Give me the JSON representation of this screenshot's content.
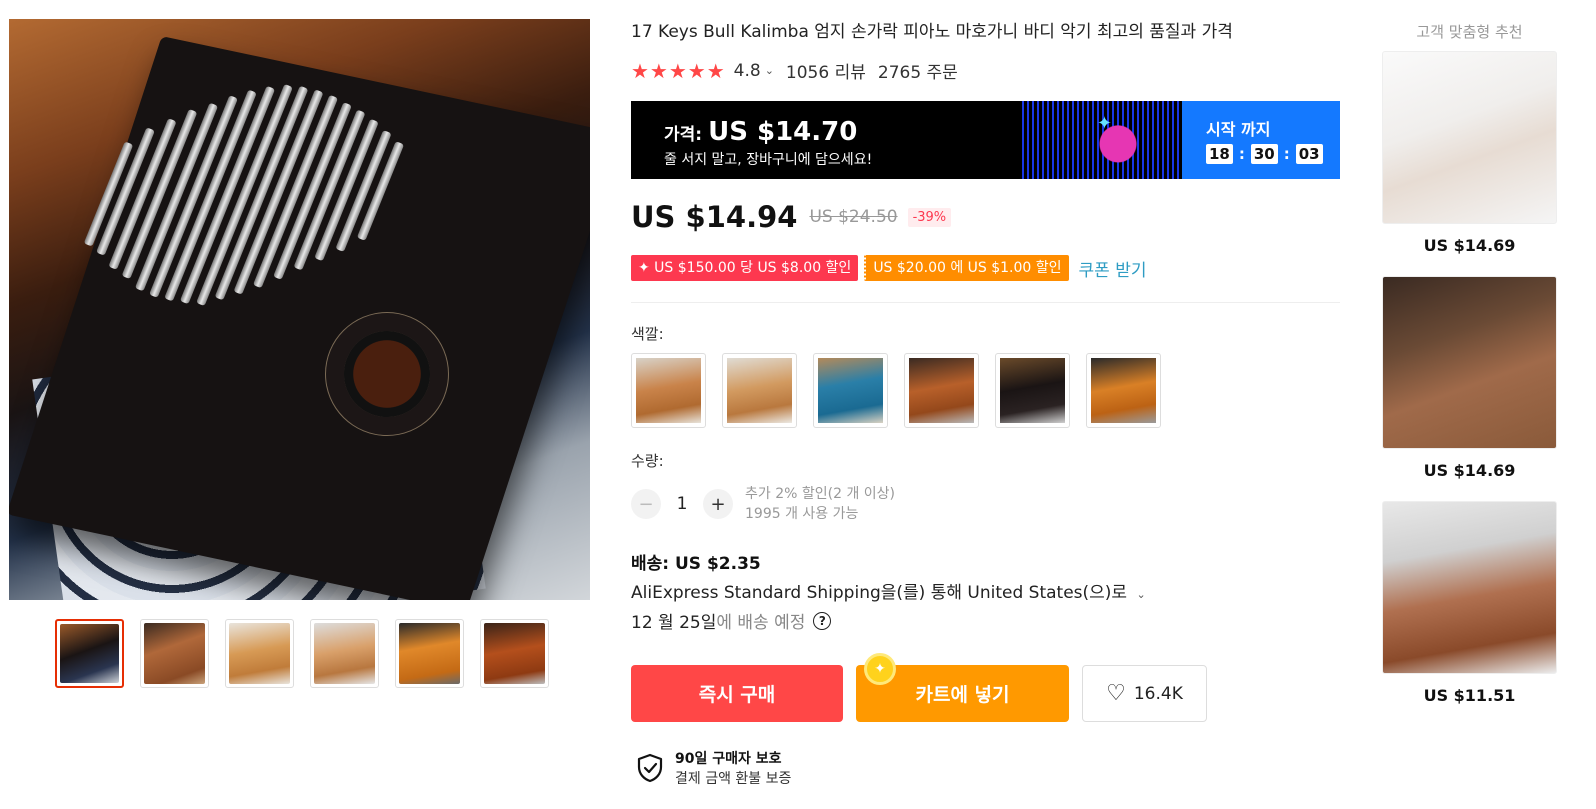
{
  "product": {
    "title": "17 Keys Bull Kalimba 엄지 손가락 피아노 마호가니 바디 악기 최고의 품질과 가격",
    "stars": "★★★★★",
    "rating": "4.8",
    "reviews": "1056 리뷰",
    "orders": "2765 주문"
  },
  "banner": {
    "price_label": "가격:",
    "price": "US $14.70",
    "subtitle": "줄 서지 말고, 장바구니에 담으세요!",
    "countdown_label": "시작 까지",
    "hours": "18",
    "minutes": "30",
    "seconds": "03"
  },
  "price": {
    "current": "US $14.94",
    "original": "US $24.50",
    "discount": "-39%"
  },
  "coupons": {
    "coupon1": "✦ US $150.00 당 US $8.00 할인",
    "coupon2": "US $20.00 에 US $1.00 할인",
    "link": "쿠폰 받기"
  },
  "options": {
    "color_label": "색깔:",
    "color_swatches": [
      "brown-wood",
      "light-wood",
      "teal-blue",
      "mahogany",
      "black",
      "orange-wood"
    ]
  },
  "quantity": {
    "label": "수량:",
    "minus": "−",
    "value": "1",
    "plus": "+",
    "extra_discount": "추가 2% 할인(2 개 이상)",
    "available": "1995 개 사용 가능"
  },
  "shipping": {
    "title": "배송: US $2.35",
    "method": "AliExpress Standard Shipping을(를) 통해 United States(으)로",
    "date": "12 월 25일",
    "date_suffix": "에 배송 예정",
    "help": "?"
  },
  "actions": {
    "buy_now": "즉시 구매",
    "add_to_cart": "카트에 넣기",
    "wishlist_count": "16.4K",
    "heart": "♡"
  },
  "protection": {
    "title": "90일 구매자 보호",
    "subtitle": "결제 금액 환불 보증"
  },
  "recommendations": {
    "title": "고객 맞춤형 추천",
    "items": [
      {
        "price": "US $14.69"
      },
      {
        "price": "US $14.69"
      },
      {
        "price": "US $11.51"
      }
    ]
  },
  "colors": {
    "accent_red": "#ff4747",
    "accent_orange": "#ff9900",
    "banner_blue": "#1479ff",
    "coupon_pink": "#fd384f",
    "link_blue": "#2e9cc3"
  }
}
